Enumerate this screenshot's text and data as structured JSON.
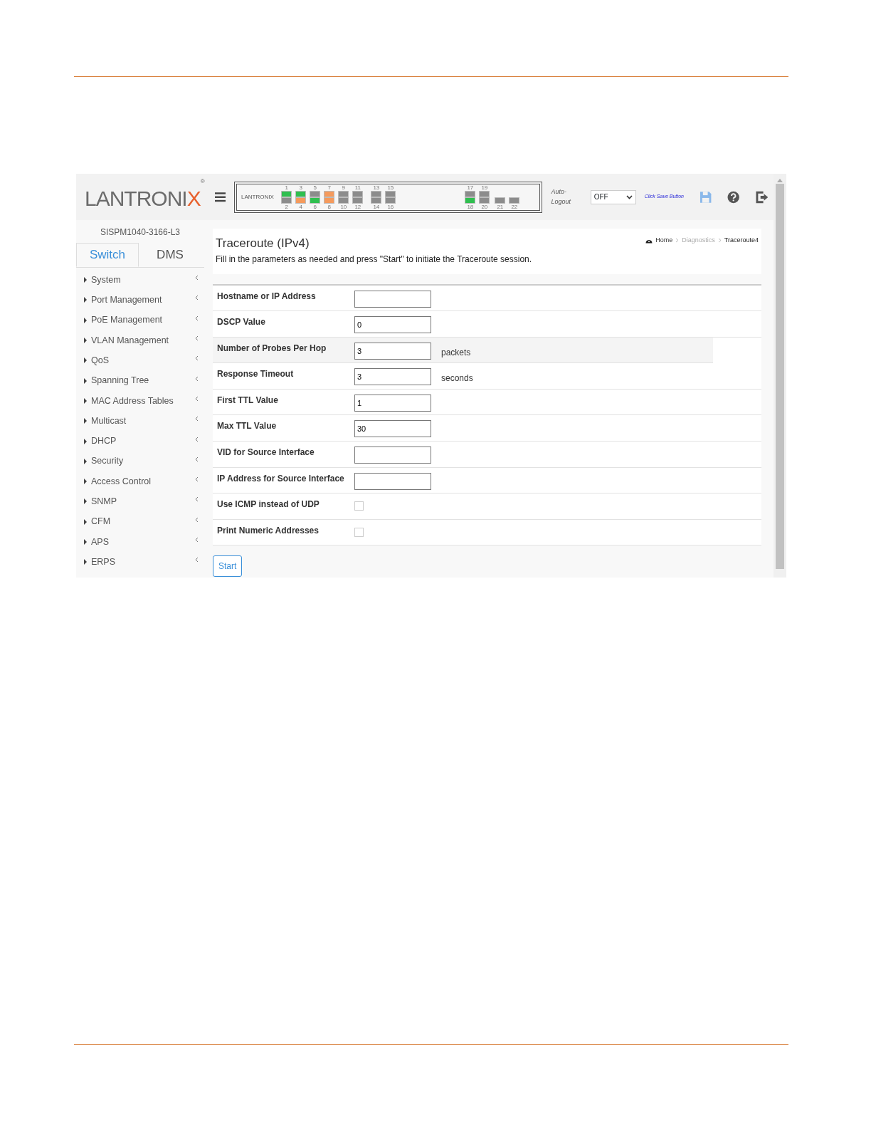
{
  "header": {
    "logo": "LANTRONIX",
    "logo_mark": "®",
    "device_panel": {
      "brand": "LANTRONIX",
      "groups": [
        {
          "columns": [
            {
              "ports": [
                {
                  "label": "1",
                  "color": "#2fbf4f"
                },
                {
                  "label": "2",
                  "color": "#8c8c8c"
                }
              ]
            },
            {
              "ports": [
                {
                  "label": "3",
                  "color": "#2fbf4f"
                },
                {
                  "label": "4",
                  "color": "#f59a5c"
                }
              ]
            },
            {
              "ports": [
                {
                  "label": "5",
                  "color": "#8c8c8c"
                },
                {
                  "label": "6",
                  "color": "#2fbf4f"
                }
              ]
            },
            {
              "ports": [
                {
                  "label": "7",
                  "color": "#f59a5c"
                },
                {
                  "label": "8",
                  "color": "#f59a5c"
                }
              ]
            },
            {
              "ports": [
                {
                  "label": "9",
                  "color": "#8c8c8c"
                },
                {
                  "label": "10",
                  "color": "#8c8c8c"
                }
              ]
            },
            {
              "ports": [
                {
                  "label": "11",
                  "color": "#8c8c8c"
                },
                {
                  "label": "12",
                  "color": "#8c8c8c"
                }
              ]
            }
          ]
        },
        {
          "columns": [
            {
              "ports": [
                {
                  "label": "13",
                  "color": "#8c8c8c"
                },
                {
                  "label": "14",
                  "color": "#8c8c8c"
                }
              ]
            },
            {
              "ports": [
                {
                  "label": "15",
                  "color": "#8c8c8c"
                },
                {
                  "label": "16",
                  "color": "#8c8c8c"
                }
              ]
            }
          ]
        },
        {
          "columns": [
            {
              "ports": [
                {
                  "label": "17",
                  "color": "#8c8c8c"
                },
                {
                  "label": "18",
                  "color": "#2fbf4f"
                }
              ]
            },
            {
              "ports": [
                {
                  "label": "19",
                  "color": "#8c8c8c"
                },
                {
                  "label": "20",
                  "color": "#8c8c8c"
                }
              ]
            }
          ]
        },
        {
          "columns": [
            {
              "ports": [
                {
                  "label": "21",
                  "color": "#8c8c8c"
                }
              ]
            },
            {
              "ports": [
                {
                  "label": "22",
                  "color": "#8c8c8c"
                }
              ]
            }
          ]
        }
      ]
    },
    "auto_logout": {
      "label": "Auto-Logout",
      "value": "OFF"
    },
    "save_hint": "Click Save Button"
  },
  "sidebar": {
    "model": "SISPM1040-3166-L3",
    "tabs": [
      {
        "label": "Switch",
        "selected": true
      },
      {
        "label": "DMS",
        "selected": false
      }
    ],
    "items": [
      "System",
      "Port Management",
      "PoE Management",
      "VLAN Management",
      "QoS",
      "Spanning Tree",
      "MAC Address Tables",
      "Multicast",
      "DHCP",
      "Security",
      "Access Control",
      "SNMP",
      "CFM",
      "APS",
      "ERPS"
    ]
  },
  "page": {
    "title": "Traceroute (IPv4)",
    "description": "Fill in the parameters as needed and press \"Start\" to initiate the Traceroute session.",
    "breadcrumb": [
      "Home",
      "Diagnostics",
      "Traceroute4"
    ]
  },
  "form": {
    "rows": [
      {
        "kind": "text",
        "label": "Hostname or IP Address",
        "hovered": false
      },
      {
        "kind": "text",
        "label": "DSCP Value",
        "value": "0",
        "hovered": false
      },
      {
        "kind": "text",
        "label": "Number of Probes Per Hop",
        "value": "3",
        "unit": "packets",
        "hovered": true
      },
      {
        "kind": "text",
        "label": "Response Timeout",
        "value": "3",
        "unit": "seconds",
        "hovered": false
      },
      {
        "kind": "text",
        "label": "First TTL Value",
        "value": "1",
        "hovered": false
      },
      {
        "kind": "text",
        "label": "Max TTL Value",
        "value": "30",
        "hovered": false
      },
      {
        "kind": "text",
        "label": "VID for Source Interface",
        "hovered": false
      },
      {
        "kind": "text",
        "label": "IP Address for Source Interface",
        "hovered": false
      },
      {
        "kind": "checkbox",
        "label": "Use ICMP instead of UDP",
        "checked": false,
        "hovered": false
      },
      {
        "kind": "checkbox",
        "label": "Print Numeric Addresses",
        "checked": false,
        "hovered": false
      }
    ],
    "button": "Start"
  }
}
